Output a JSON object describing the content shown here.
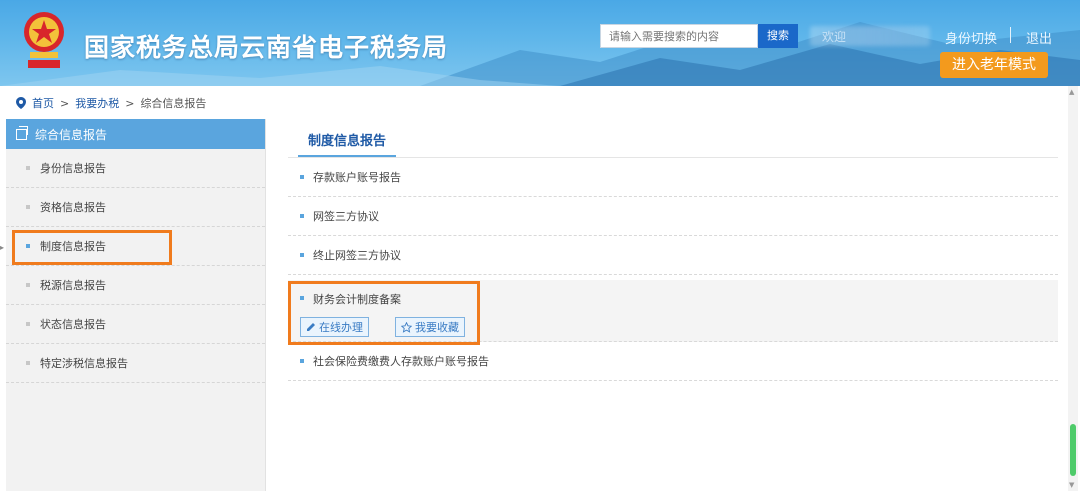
{
  "header": {
    "site_title": "国家税务总局云南省电子税务局",
    "search_placeholder": "请输入需要搜索的内容",
    "search_button": "搜索",
    "user_greeting": "欢迎",
    "switch_identity": "身份切换",
    "logout": "退出",
    "elder_mode_button": "进入老年模式",
    "brand_color": "#4aa8e6",
    "accent_color": "#f39a1d"
  },
  "breadcrumb": {
    "home": "首页",
    "sep1": ">",
    "level1": "我要办税",
    "sep2": ">",
    "level2": "综合信息报告"
  },
  "sidebar": {
    "title": "综合信息报告",
    "items": [
      {
        "label": "身份信息报告"
      },
      {
        "label": "资格信息报告"
      },
      {
        "label": "制度信息报告",
        "active": true
      },
      {
        "label": "税源信息报告"
      },
      {
        "label": "状态信息报告"
      },
      {
        "label": "特定涉税信息报告"
      }
    ]
  },
  "main": {
    "tab_title": "制度信息报告",
    "reports": [
      {
        "label": "存款账户账号报告"
      },
      {
        "label": "网签三方协议"
      },
      {
        "label": "终止网签三方协议"
      },
      {
        "label": "财务会计制度备案",
        "expanded": true
      },
      {
        "label": "社会保险费缴费人存款账户账号报告"
      }
    ],
    "actions": {
      "handle_online": "在线办理",
      "favorite": "我要收藏"
    }
  },
  "highlight_color": "#f07b1d"
}
